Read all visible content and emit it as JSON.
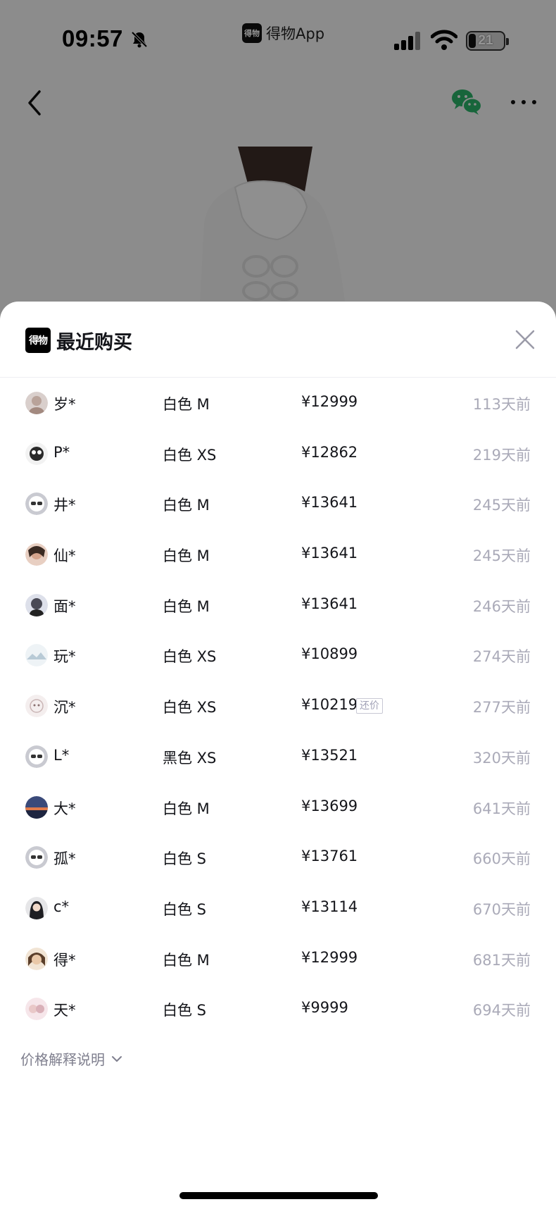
{
  "status_bar": {
    "time": "09:57",
    "app_name": "得物App",
    "battery_level": "21"
  },
  "brand_logo_text": "得物",
  "sheet": {
    "title": "最近购买",
    "rows": [
      {
        "user": "岁*",
        "spec": "白色 M",
        "price": "¥12999",
        "badge": "",
        "time_ago": "113天前",
        "avatar_color": "#b9a39a"
      },
      {
        "user": "P*",
        "spec": "白色 XS",
        "price": "¥12862",
        "badge": "",
        "time_ago": "219天前",
        "avatar_color": "#2a2a2a"
      },
      {
        "user": "井*",
        "spec": "白色 M",
        "price": "¥13641",
        "badge": "",
        "time_ago": "245天前",
        "avatar_color": "#c9cad1"
      },
      {
        "user": "仙*",
        "spec": "白色 M",
        "price": "¥13641",
        "badge": "",
        "time_ago": "245天前",
        "avatar_color": "#d6a58d"
      },
      {
        "user": "面*",
        "spec": "白色 M",
        "price": "¥13641",
        "badge": "",
        "time_ago": "246天前",
        "avatar_color": "#4a4a55"
      },
      {
        "user": "玩*",
        "spec": "白色 XS",
        "price": "¥10899",
        "badge": "",
        "time_ago": "274天前",
        "avatar_color": "#d8e4ea"
      },
      {
        "user": "沉*",
        "spec": "白色 XS",
        "price": "¥10219",
        "badge": "还价",
        "time_ago": "277天前",
        "avatar_color": "#eee6e6"
      },
      {
        "user": "L*",
        "spec": "黑色 XS",
        "price": "¥13521",
        "badge": "",
        "time_ago": "320天前",
        "avatar_color": "#c9cad1"
      },
      {
        "user": "大*",
        "spec": "白色 M",
        "price": "¥13699",
        "badge": "",
        "time_ago": "641天前",
        "avatar_color": "#3a4a7a"
      },
      {
        "user": "孤*",
        "spec": "白色 S",
        "price": "¥13761",
        "badge": "",
        "time_ago": "660天前",
        "avatar_color": "#c9cad1"
      },
      {
        "user": "c*",
        "spec": "白色 S",
        "price": "¥13114",
        "badge": "",
        "time_ago": "670天前",
        "avatar_color": "#1e1e22"
      },
      {
        "user": "得*",
        "spec": "白色 M",
        "price": "¥12999",
        "badge": "",
        "time_ago": "681天前",
        "avatar_color": "#c8a27e"
      },
      {
        "user": "天*",
        "spec": "白色 S",
        "price": "¥9999",
        "badge": "",
        "time_ago": "694天前",
        "avatar_color": "#e9c8c8"
      }
    ],
    "price_note": "价格解释说明"
  },
  "icons": [
    "back-icon",
    "wechat-icon",
    "more-icon",
    "close-icon",
    "chevron-down-icon",
    "bell-muted-icon",
    "signal-icon",
    "wifi-icon",
    "battery-icon"
  ],
  "colors": {
    "primary_text": "#14151a",
    "secondary_text": "#aaaab8",
    "wechat_green": "#2aae67",
    "overlay": "rgba(0,0,0,0.42)"
  }
}
